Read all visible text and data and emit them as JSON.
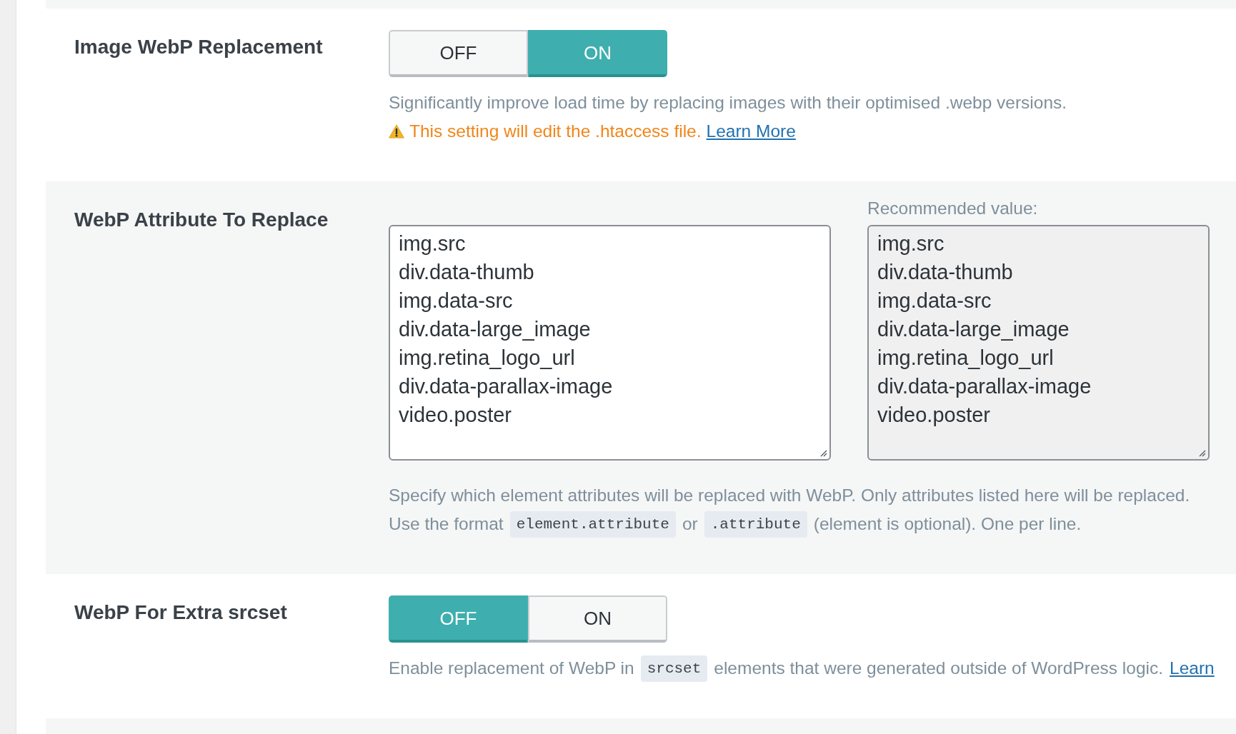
{
  "settings": [
    {
      "kind": "toggle",
      "label": "Image WebP Replacement",
      "options": [
        {
          "label": "OFF",
          "selected": false
        },
        {
          "label": "ON",
          "selected": true
        }
      ],
      "notes": [
        {
          "kind": "plain",
          "parts": [
            {
              "kind": "text",
              "text": "Significantly improve load time by replacing images with their optimised .webp versions."
            }
          ]
        },
        {
          "kind": "warning",
          "parts": [
            {
              "kind": "text",
              "text": "This setting will edit the .htaccess file."
            },
            {
              "kind": "link",
              "text": "Learn More"
            }
          ]
        }
      ]
    },
    {
      "kind": "textarea",
      "label": "WebP Attribute To Replace",
      "value": [
        "img.src",
        "div.data-thumb",
        "img.data-src",
        "div.data-large_image",
        "img.retina_logo_url",
        "div.data-parallax-image",
        "video.poster"
      ],
      "recommended": {
        "label": "Recommended value:",
        "value": [
          "img.src",
          "div.data-thumb",
          "img.data-src",
          "div.data-large_image",
          "img.retina_logo_url",
          "div.data-parallax-image",
          "video.poster"
        ]
      },
      "notes": [
        {
          "kind": "plain",
          "parts": [
            {
              "kind": "text",
              "text": "Specify which element attributes will be replaced with WebP. Only attributes listed here will be replaced."
            }
          ]
        },
        {
          "kind": "plain",
          "parts": [
            {
              "kind": "text",
              "text": "Use the format"
            },
            {
              "kind": "code",
              "text": "element.attribute"
            },
            {
              "kind": "text",
              "text": "or"
            },
            {
              "kind": "code",
              "text": ".attribute"
            },
            {
              "kind": "text",
              "text": "(element is optional). One per line."
            }
          ]
        }
      ]
    },
    {
      "kind": "toggle",
      "label": "WebP For Extra srcset",
      "options": [
        {
          "label": "OFF",
          "selected": true
        },
        {
          "label": "ON",
          "selected": false
        }
      ],
      "notes": [
        {
          "kind": "plain",
          "parts": [
            {
              "kind": "text",
              "text": "Enable replacement of WebP in"
            },
            {
              "kind": "code",
              "text": "srcset"
            },
            {
              "kind": "text",
              "text": "elements that were generated outside of WordPress logic."
            },
            {
              "kind": "link",
              "text": "Learn"
            }
          ]
        }
      ]
    }
  ]
}
